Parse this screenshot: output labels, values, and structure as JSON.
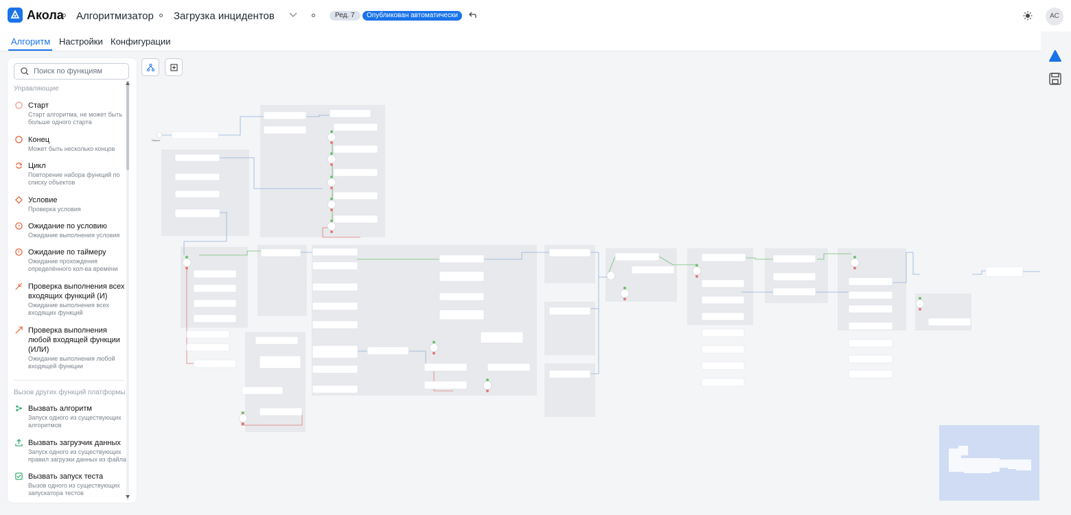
{
  "header": {
    "brand": "Акола",
    "crumbs": [
      "Алгоритмизатор",
      "Загрузка инцидентов"
    ],
    "version_badge": "Ред. 7",
    "status_badge": "Опубликован автоматически",
    "user_initials": "АС"
  },
  "tabs": [
    {
      "label": "Алгоритм",
      "active": true
    },
    {
      "label": "Настройки",
      "active": false
    },
    {
      "label": "Конфигурации",
      "active": false
    }
  ],
  "palette": {
    "search_placeholder": "Поиск по функциям",
    "section_control": "Управляющие",
    "section_calls": "Вызов других функций платформы",
    "items": [
      {
        "name": "Старт",
        "desc": "Старт алгоритма, не может быть больше одного старта",
        "icon": "start-icon",
        "color": "#f0a090"
      },
      {
        "name": "Конец",
        "desc": "Может быть несколько концов",
        "icon": "end-icon",
        "color": "#e8663d"
      },
      {
        "name": "Цикл",
        "desc": "Повторение набора функций по списку объектов",
        "icon": "loop-icon",
        "color": "#e8663d"
      },
      {
        "name": "Условие",
        "desc": "Проверка условия",
        "icon": "condition-icon",
        "color": "#e8663d"
      },
      {
        "name": "Ожидание по условию",
        "desc": "Ожидание выполнения условия",
        "icon": "wait-condition-icon",
        "color": "#e8663d"
      },
      {
        "name": "Ожидание по таймеру",
        "desc": "Ожидание прохождения определённого кол-ва времени",
        "icon": "timer-icon",
        "color": "#e8663d"
      },
      {
        "name": "Проверка выполнения всех входящих функций (И)",
        "desc": "Ожидание выполнения всех входящих функций",
        "icon": "join-all-icon",
        "color": "#e8663d"
      },
      {
        "name": "Проверка выполнения любой входящей функции (ИЛИ)",
        "desc": "Ожидание выполнения любой входящей функции",
        "icon": "join-any-icon",
        "color": "#e8663d"
      },
      {
        "name": "Вызвать алгоритм",
        "desc": "Запуск одного из существующих алгоритмов",
        "icon": "call-algorithm-icon",
        "color": "#2aa86b"
      },
      {
        "name": "Вызвать загрузчик данных",
        "desc": "Запуск одного из существующих правил загрузки данных из файла",
        "icon": "call-loader-icon",
        "color": "#2aa86b"
      },
      {
        "name": "Вызвать запуск теста",
        "desc": "Вызов одного из существующих запускатора тестов",
        "icon": "call-test-icon",
        "color": "#2aa86b"
      }
    ]
  },
  "canvas": {
    "start_label": "Начало"
  },
  "colors": {
    "accent": "#1a73e8",
    "control_icon": "#e8663d",
    "call_icon": "#2aa86b",
    "minimap": "#cfdcf3"
  }
}
